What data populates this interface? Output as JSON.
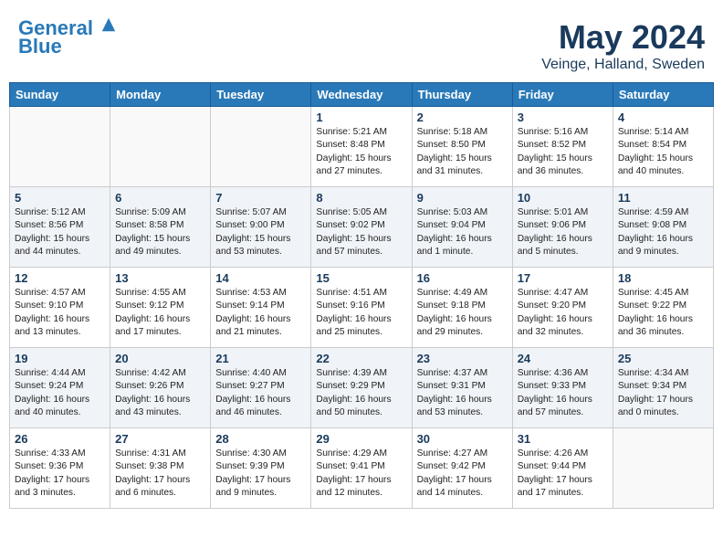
{
  "header": {
    "logo_line1": "General",
    "logo_line2": "Blue",
    "month_year": "May 2024",
    "location": "Veinge, Halland, Sweden"
  },
  "days_of_week": [
    "Sunday",
    "Monday",
    "Tuesday",
    "Wednesday",
    "Thursday",
    "Friday",
    "Saturday"
  ],
  "weeks": [
    {
      "days": [
        {
          "number": "",
          "detail": ""
        },
        {
          "number": "",
          "detail": ""
        },
        {
          "number": "",
          "detail": ""
        },
        {
          "number": "1",
          "detail": "Sunrise: 5:21 AM\nSunset: 8:48 PM\nDaylight: 15 hours\nand 27 minutes."
        },
        {
          "number": "2",
          "detail": "Sunrise: 5:18 AM\nSunset: 8:50 PM\nDaylight: 15 hours\nand 31 minutes."
        },
        {
          "number": "3",
          "detail": "Sunrise: 5:16 AM\nSunset: 8:52 PM\nDaylight: 15 hours\nand 36 minutes."
        },
        {
          "number": "4",
          "detail": "Sunrise: 5:14 AM\nSunset: 8:54 PM\nDaylight: 15 hours\nand 40 minutes."
        }
      ]
    },
    {
      "days": [
        {
          "number": "5",
          "detail": "Sunrise: 5:12 AM\nSunset: 8:56 PM\nDaylight: 15 hours\nand 44 minutes."
        },
        {
          "number": "6",
          "detail": "Sunrise: 5:09 AM\nSunset: 8:58 PM\nDaylight: 15 hours\nand 49 minutes."
        },
        {
          "number": "7",
          "detail": "Sunrise: 5:07 AM\nSunset: 9:00 PM\nDaylight: 15 hours\nand 53 minutes."
        },
        {
          "number": "8",
          "detail": "Sunrise: 5:05 AM\nSunset: 9:02 PM\nDaylight: 15 hours\nand 57 minutes."
        },
        {
          "number": "9",
          "detail": "Sunrise: 5:03 AM\nSunset: 9:04 PM\nDaylight: 16 hours\nand 1 minute."
        },
        {
          "number": "10",
          "detail": "Sunrise: 5:01 AM\nSunset: 9:06 PM\nDaylight: 16 hours\nand 5 minutes."
        },
        {
          "number": "11",
          "detail": "Sunrise: 4:59 AM\nSunset: 9:08 PM\nDaylight: 16 hours\nand 9 minutes."
        }
      ]
    },
    {
      "days": [
        {
          "number": "12",
          "detail": "Sunrise: 4:57 AM\nSunset: 9:10 PM\nDaylight: 16 hours\nand 13 minutes."
        },
        {
          "number": "13",
          "detail": "Sunrise: 4:55 AM\nSunset: 9:12 PM\nDaylight: 16 hours\nand 17 minutes."
        },
        {
          "number": "14",
          "detail": "Sunrise: 4:53 AM\nSunset: 9:14 PM\nDaylight: 16 hours\nand 21 minutes."
        },
        {
          "number": "15",
          "detail": "Sunrise: 4:51 AM\nSunset: 9:16 PM\nDaylight: 16 hours\nand 25 minutes."
        },
        {
          "number": "16",
          "detail": "Sunrise: 4:49 AM\nSunset: 9:18 PM\nDaylight: 16 hours\nand 29 minutes."
        },
        {
          "number": "17",
          "detail": "Sunrise: 4:47 AM\nSunset: 9:20 PM\nDaylight: 16 hours\nand 32 minutes."
        },
        {
          "number": "18",
          "detail": "Sunrise: 4:45 AM\nSunset: 9:22 PM\nDaylight: 16 hours\nand 36 minutes."
        }
      ]
    },
    {
      "days": [
        {
          "number": "19",
          "detail": "Sunrise: 4:44 AM\nSunset: 9:24 PM\nDaylight: 16 hours\nand 40 minutes."
        },
        {
          "number": "20",
          "detail": "Sunrise: 4:42 AM\nSunset: 9:26 PM\nDaylight: 16 hours\nand 43 minutes."
        },
        {
          "number": "21",
          "detail": "Sunrise: 4:40 AM\nSunset: 9:27 PM\nDaylight: 16 hours\nand 46 minutes."
        },
        {
          "number": "22",
          "detail": "Sunrise: 4:39 AM\nSunset: 9:29 PM\nDaylight: 16 hours\nand 50 minutes."
        },
        {
          "number": "23",
          "detail": "Sunrise: 4:37 AM\nSunset: 9:31 PM\nDaylight: 16 hours\nand 53 minutes."
        },
        {
          "number": "24",
          "detail": "Sunrise: 4:36 AM\nSunset: 9:33 PM\nDaylight: 16 hours\nand 57 minutes."
        },
        {
          "number": "25",
          "detail": "Sunrise: 4:34 AM\nSunset: 9:34 PM\nDaylight: 17 hours\nand 0 minutes."
        }
      ]
    },
    {
      "days": [
        {
          "number": "26",
          "detail": "Sunrise: 4:33 AM\nSunset: 9:36 PM\nDaylight: 17 hours\nand 3 minutes."
        },
        {
          "number": "27",
          "detail": "Sunrise: 4:31 AM\nSunset: 9:38 PM\nDaylight: 17 hours\nand 6 minutes."
        },
        {
          "number": "28",
          "detail": "Sunrise: 4:30 AM\nSunset: 9:39 PM\nDaylight: 17 hours\nand 9 minutes."
        },
        {
          "number": "29",
          "detail": "Sunrise: 4:29 AM\nSunset: 9:41 PM\nDaylight: 17 hours\nand 12 minutes."
        },
        {
          "number": "30",
          "detail": "Sunrise: 4:27 AM\nSunset: 9:42 PM\nDaylight: 17 hours\nand 14 minutes."
        },
        {
          "number": "31",
          "detail": "Sunrise: 4:26 AM\nSunset: 9:44 PM\nDaylight: 17 hours\nand 17 minutes."
        },
        {
          "number": "",
          "detail": ""
        }
      ]
    }
  ]
}
